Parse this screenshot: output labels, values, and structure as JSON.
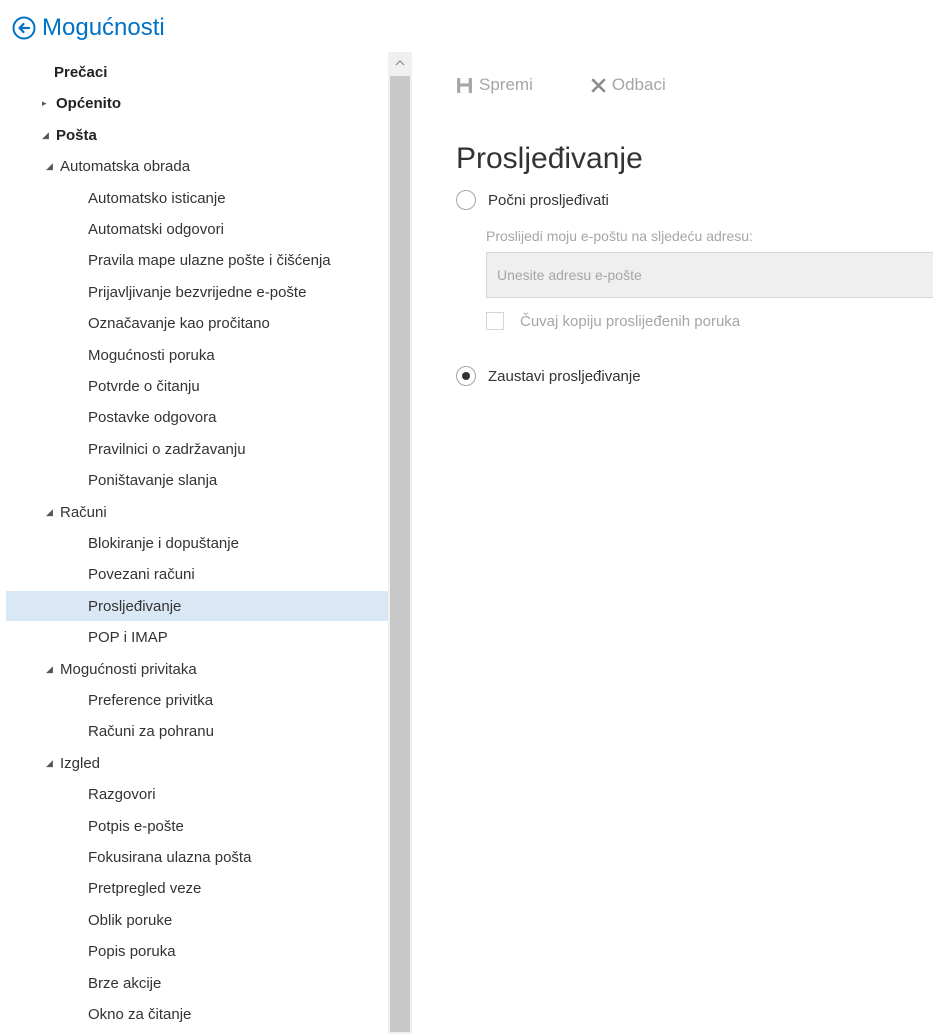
{
  "header": {
    "title": "Mogućnosti",
    "back_icon": "back-arrow-icon"
  },
  "sidebar": {
    "items": [
      {
        "label": "Prečaci",
        "level": 0,
        "toggle": ""
      },
      {
        "label": "Općenito",
        "level": 0,
        "toggle": "▸"
      },
      {
        "label": "Pošta",
        "level": 0,
        "toggle": "◢"
      },
      {
        "label": "Automatska obrada",
        "level": 1,
        "toggle": "◢"
      },
      {
        "label": "Automatsko isticanje",
        "level": 2,
        "toggle": ""
      },
      {
        "label": "Automatski odgovori",
        "level": 2,
        "toggle": ""
      },
      {
        "label": "Pravila mape ulazne pošte i čišćenja",
        "level": 2,
        "toggle": ""
      },
      {
        "label": "Prijavljivanje bezvrijedne e-pošte",
        "level": 2,
        "toggle": ""
      },
      {
        "label": "Označavanje kao pročitano",
        "level": 2,
        "toggle": ""
      },
      {
        "label": "Mogućnosti poruka",
        "level": 2,
        "toggle": ""
      },
      {
        "label": "Potvrde o čitanju",
        "level": 2,
        "toggle": ""
      },
      {
        "label": "Postavke odgovora",
        "level": 2,
        "toggle": ""
      },
      {
        "label": "Pravilnici o zadržavanju",
        "level": 2,
        "toggle": ""
      },
      {
        "label": "Poništavanje slanja",
        "level": 2,
        "toggle": ""
      },
      {
        "label": "Računi",
        "level": 1,
        "toggle": "◢"
      },
      {
        "label": "Blokiranje i dopuštanje",
        "level": 2,
        "toggle": ""
      },
      {
        "label": "Povezani računi",
        "level": 2,
        "toggle": ""
      },
      {
        "label": "Prosljeđivanje",
        "level": 2,
        "toggle": "",
        "selected": true
      },
      {
        "label": "POP i IMAP",
        "level": 2,
        "toggle": ""
      },
      {
        "label": "Mogućnosti privitaka",
        "level": 1,
        "toggle": "◢"
      },
      {
        "label": "Preference privitka",
        "level": 2,
        "toggle": ""
      },
      {
        "label": "Računi za pohranu",
        "level": 2,
        "toggle": ""
      },
      {
        "label": "Izgled",
        "level": 1,
        "toggle": "◢"
      },
      {
        "label": "Razgovori",
        "level": 2,
        "toggle": ""
      },
      {
        "label": "Potpis e-pošte",
        "level": 2,
        "toggle": ""
      },
      {
        "label": "Fokusirana ulazna pošta",
        "level": 2,
        "toggle": ""
      },
      {
        "label": "Pretpregled veze",
        "level": 2,
        "toggle": ""
      },
      {
        "label": "Oblik poruke",
        "level": 2,
        "toggle": ""
      },
      {
        "label": "Popis poruka",
        "level": 2,
        "toggle": ""
      },
      {
        "label": "Brze akcije",
        "level": 2,
        "toggle": ""
      },
      {
        "label": "Okno za čitanje",
        "level": 2,
        "toggle": ""
      }
    ]
  },
  "toolbar": {
    "save_label": "Spremi",
    "discard_label": "Odbaci"
  },
  "content": {
    "title": "Prosljeđivanje",
    "start_forwarding_label": "Počni prosljeđivati",
    "forward_description": "Proslijedi moju e-poštu na sljedeću adresu:",
    "email_placeholder": "Unesite adresu e-pošte",
    "email_value": "",
    "keep_copy_label": "Čuvaj kopiju proslijeđenih poruka",
    "keep_copy_checked": false,
    "stop_forwarding_label": "Zaustavi prosljeđivanje",
    "selected_option": "stop"
  },
  "colors": {
    "accent": "#0072c6",
    "selected_bg": "#dae8f5",
    "disabled_text": "#a6a6a6",
    "scroll_thumb": "#c8c8c8"
  }
}
